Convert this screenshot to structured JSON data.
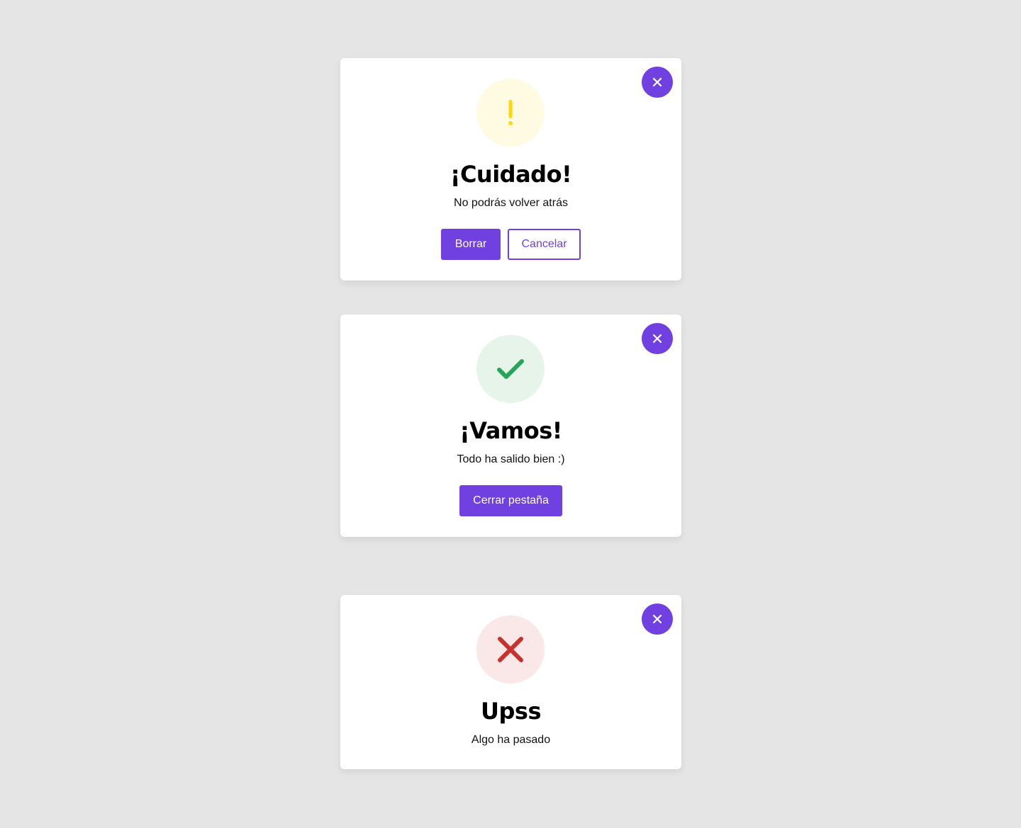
{
  "colors": {
    "page_background": "#e5e5e5",
    "accent": "#7040e0",
    "warning_icon": "#ffd60a",
    "warning_bg": "#fffbe3",
    "success_icon": "#27a65a",
    "success_bg": "#e6f4ea",
    "error_icon": "#c8322e",
    "error_bg": "#f9e8e7"
  },
  "modals": {
    "warning": {
      "icon": "exclamation-icon",
      "title": "¡Cuidado!",
      "message": "No podrás volver atrás",
      "primary_label": "Borrar",
      "secondary_label": "Cancelar",
      "close_icon": "close-icon"
    },
    "success": {
      "icon": "checkmark-icon",
      "title": "¡Vamos!",
      "message": "Todo ha salido bien :)",
      "primary_label": "Cerrar pestaña",
      "close_icon": "close-icon"
    },
    "error": {
      "icon": "x-mark-icon",
      "title": "Upss",
      "message": "Algo ha pasado",
      "close_icon": "close-icon"
    }
  }
}
